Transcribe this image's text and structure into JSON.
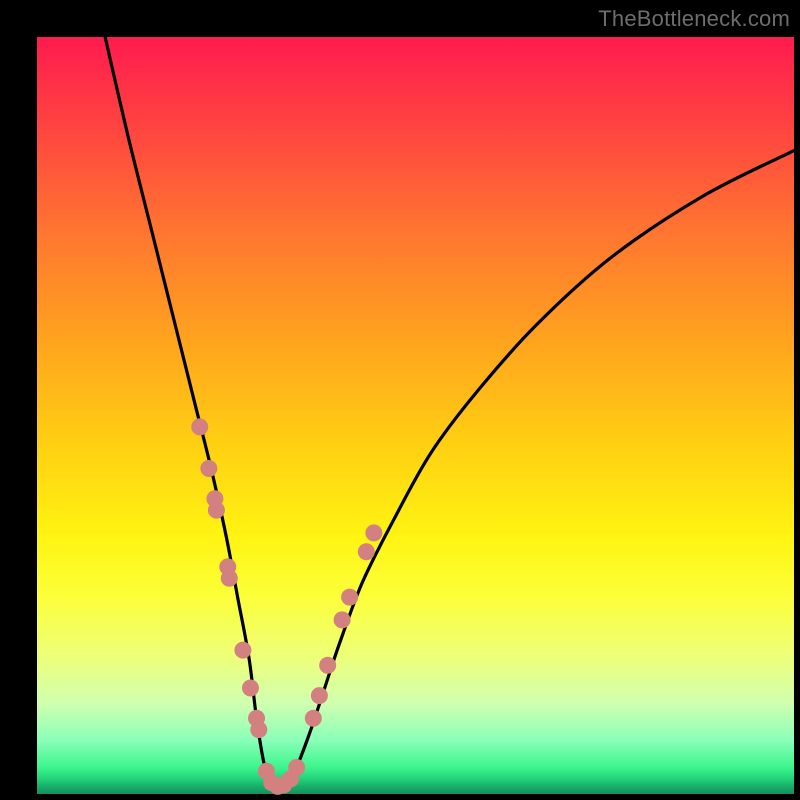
{
  "watermark": "TheBottleneck.com",
  "colors": {
    "background": "#000000",
    "curve": "#000000",
    "marker_fill": "#d38080",
    "marker_stroke": "#c46e6e"
  },
  "chart_data": {
    "type": "line",
    "title": "",
    "xlabel": "",
    "ylabel": "",
    "xlim": [
      0,
      100
    ],
    "ylim": [
      0,
      100
    ],
    "grid": false,
    "legend": false,
    "annotations": [
      "TheBottleneck.com"
    ],
    "series": [
      {
        "name": "bottleneck-curve",
        "x": [
          9,
          12,
          15,
          17,
          19,
          21,
          23,
          25,
          26.5,
          28,
          29,
          30,
          31,
          32,
          34,
          36,
          38,
          40,
          43,
          47,
          52,
          58,
          66,
          76,
          88,
          100
        ],
        "y": [
          100,
          87,
          75,
          67,
          59,
          51,
          43,
          34,
          26,
          18,
          10,
          4,
          1,
          1,
          3,
          8,
          14,
          20,
          28,
          36,
          45,
          53,
          62,
          71,
          79,
          85
        ]
      }
    ],
    "markers": {
      "left_branch": [
        [
          21.5,
          48.5
        ],
        [
          22.7,
          43
        ],
        [
          23.5,
          39
        ],
        [
          23.7,
          37.5
        ],
        [
          25.2,
          30
        ],
        [
          25.4,
          28.5
        ],
        [
          27.2,
          19
        ],
        [
          28.2,
          14
        ],
        [
          29,
          10
        ],
        [
          29.3,
          8.5
        ]
      ],
      "valley": [
        [
          30.3,
          3
        ],
        [
          31,
          1.5
        ],
        [
          31.8,
          1
        ],
        [
          32.6,
          1.2
        ],
        [
          33.5,
          2
        ],
        [
          34.3,
          3.5
        ]
      ],
      "right_branch": [
        [
          36.5,
          10
        ],
        [
          37.3,
          13
        ],
        [
          38.4,
          17
        ],
        [
          40.3,
          23
        ],
        [
          41.3,
          26
        ],
        [
          43.5,
          32
        ],
        [
          44.5,
          34.5
        ]
      ]
    }
  }
}
